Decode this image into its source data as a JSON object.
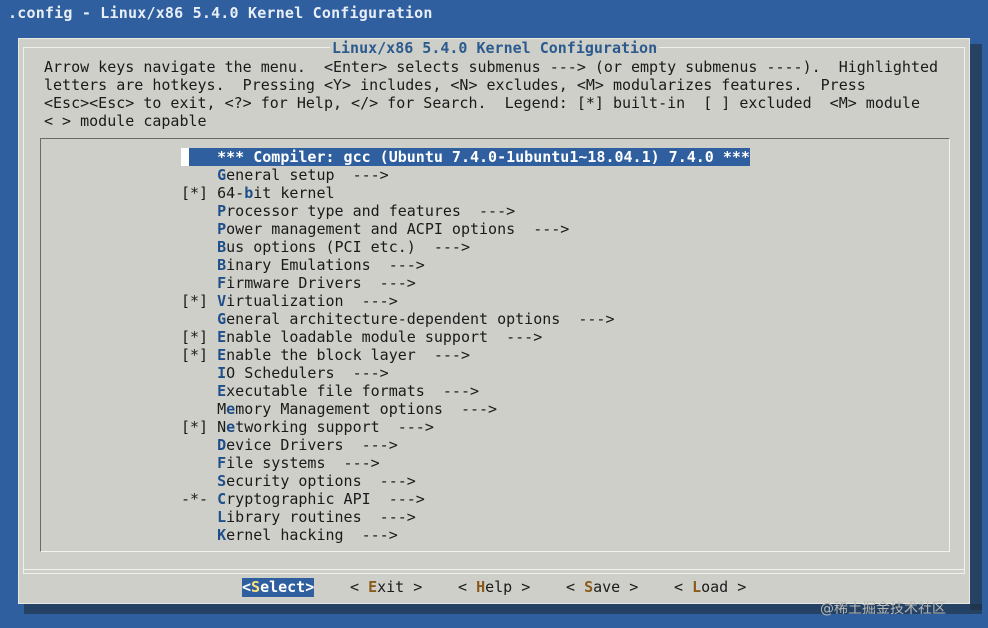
{
  "window": {
    "title": ".config - Linux/x86 5.4.0 Kernel Configuration"
  },
  "dialog": {
    "title": "Linux/x86 5.4.0 Kernel Configuration"
  },
  "help_lines": [
    "Arrow keys navigate the menu.  <Enter> selects submenus ---> (or empty submenus ----).  Highlighted",
    "letters are hotkeys.  Pressing <Y> includes, <N> excludes, <M> modularizes features.  Press",
    "<Esc><Esc> to exit, <?> for Help, </> for Search.  Legend: [*] built-in  [ ] excluded  <M> module",
    "< > module capable"
  ],
  "menu": {
    "items": [
      {
        "prefix": "   ",
        "hot": "",
        "rest": " *** Compiler: gcc (Ubuntu 7.4.0-1ubuntu1~18.04.1) 7.4.0 ***",
        "selected": true
      },
      {
        "prefix": "    ",
        "hot": "G",
        "rest": "eneral setup  --->"
      },
      {
        "prefix": "[*] ",
        "hot": "",
        "rest": "64-",
        "hot2": "b",
        "rest2": "it kernel"
      },
      {
        "prefix": "    ",
        "hot": "P",
        "rest": "rocessor type and features  --->"
      },
      {
        "prefix": "    ",
        "hot": "P",
        "rest": "ower management and ACPI options  --->"
      },
      {
        "prefix": "    ",
        "hot": "B",
        "rest": "us options (PCI etc.)  --->"
      },
      {
        "prefix": "    ",
        "hot": "B",
        "rest": "inary Emulations  --->"
      },
      {
        "prefix": "    ",
        "hot": "F",
        "rest": "irmware Drivers  --->"
      },
      {
        "prefix": "[*] ",
        "hot": "V",
        "rest": "irtualization  --->"
      },
      {
        "prefix": "    ",
        "hot": "G",
        "rest": "eneral architecture-dependent options  --->"
      },
      {
        "prefix": "[*] ",
        "hot": "E",
        "rest": "nable loadable module support  --->"
      },
      {
        "prefix": "[*] ",
        "hot": "E",
        "rest": "nable the block layer  --->"
      },
      {
        "prefix": "    ",
        "hot": "I",
        "rest": "O Schedulers  --->"
      },
      {
        "prefix": "    ",
        "hot": "E",
        "rest": "xecutable file formats  --->"
      },
      {
        "prefix": "    ",
        "hot": "",
        "rest": "M",
        "hot2": "e",
        "rest2": "mory Management options  --->"
      },
      {
        "prefix": "[*] ",
        "hot": "",
        "rest": "N",
        "hot2": "e",
        "rest2": "tworking support  --->"
      },
      {
        "prefix": "    ",
        "hot": "D",
        "rest": "evice Drivers  --->"
      },
      {
        "prefix": "    ",
        "hot": "F",
        "rest": "ile systems  --->"
      },
      {
        "prefix": "    ",
        "hot": "S",
        "rest": "ecurity options  --->"
      },
      {
        "prefix": "-*- ",
        "hot": "C",
        "rest": "ryptographic API  --->"
      },
      {
        "prefix": "    ",
        "hot": "L",
        "rest": "ibrary routines  --->"
      },
      {
        "prefix": "    ",
        "hot": "K",
        "rest": "ernel hacking  --->"
      }
    ]
  },
  "buttons": {
    "select": {
      "pre": "<",
      "hot": "S",
      "post": "elect>"
    },
    "exit": {
      "pre": "< ",
      "hot": "E",
      "post": "xit >"
    },
    "help": {
      "pre": "< ",
      "hot": "H",
      "post": "elp >"
    },
    "save": {
      "pre": "< ",
      "hot": "S",
      "post": "ave >"
    },
    "load": {
      "pre": "< ",
      "hot": "L",
      "post": "oad >"
    }
  },
  "watermark": "@稀土掘金技术社区",
  "colors": {
    "background": "#2f5f9f",
    "dialog": "#cfcfc9",
    "highlight": "#2f5f9f"
  }
}
